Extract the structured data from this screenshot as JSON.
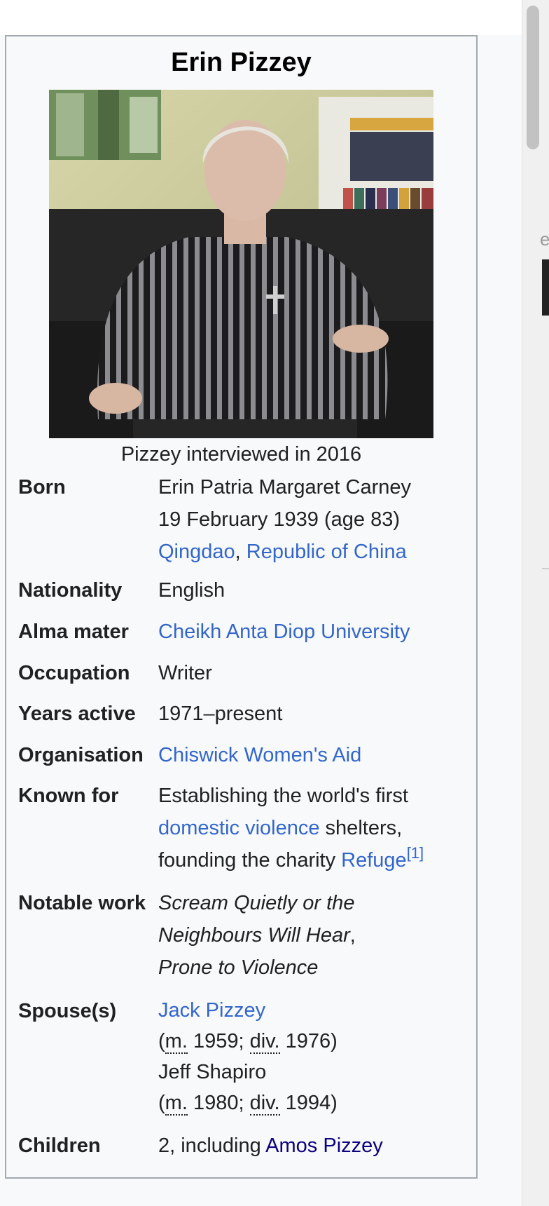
{
  "infobox": {
    "title": "Erin Pizzey",
    "image_caption": "Pizzey interviewed in 2016",
    "born": {
      "label": "Born",
      "name": "Erin Patria Margaret Carney",
      "date": "19 February 1939 (age 83)",
      "place_city": "Qingdao",
      "place_sep": ",",
      "place_country": "Republic of China"
    },
    "nationality": {
      "label": "Nationality",
      "value": "English"
    },
    "alma_mater": {
      "label": "Alma mater",
      "value": "Cheikh Anta Diop University"
    },
    "occupation": {
      "label": "Occupation",
      "value": "Writer"
    },
    "years_active": {
      "label": "Years active",
      "value": "1971–present"
    },
    "organisation": {
      "label": "Organisation",
      "value": "Chiswick Women's Aid"
    },
    "known_for": {
      "label": "Known for",
      "line1": "Establishing the world's first",
      "link_dv": "domestic violence",
      "after_dv": " shelters,",
      "line3_pre": "founding the charity ",
      "link_refuge": "Refuge",
      "ref": "[1]"
    },
    "notable_work": {
      "label": "Notable work",
      "line1": "Scream Quietly or the",
      "line2": "Neighbours Will Hear",
      "line2_sep": ",",
      "line3": "Prone to Violence"
    },
    "spouses": {
      "label": "Spouse(s)",
      "spouse1_name": "Jack Pizzey",
      "spouse1_open": "(",
      "spouse1_m": "m.",
      "spouse1_m_year": " 1959; ",
      "spouse1_div": "div.",
      "spouse1_div_year": " 1976)",
      "spouse2_name": "Jeff Shapiro",
      "spouse2_open": "(",
      "spouse2_m": "m.",
      "spouse2_m_year": " 1980; ",
      "spouse2_div": "div.",
      "spouse2_div_year": " 1994)"
    },
    "children": {
      "label": "Children",
      "pre": "2, including ",
      "link": "Amos Pizzey"
    }
  },
  "chrome": {
    "edge_letter": "e"
  },
  "colors": {
    "link": "#3366cc",
    "visited_link": "#0b0080",
    "infobox_bg": "#f8f9fa",
    "infobox_border": "#a2a9b1",
    "text": "#202122"
  }
}
